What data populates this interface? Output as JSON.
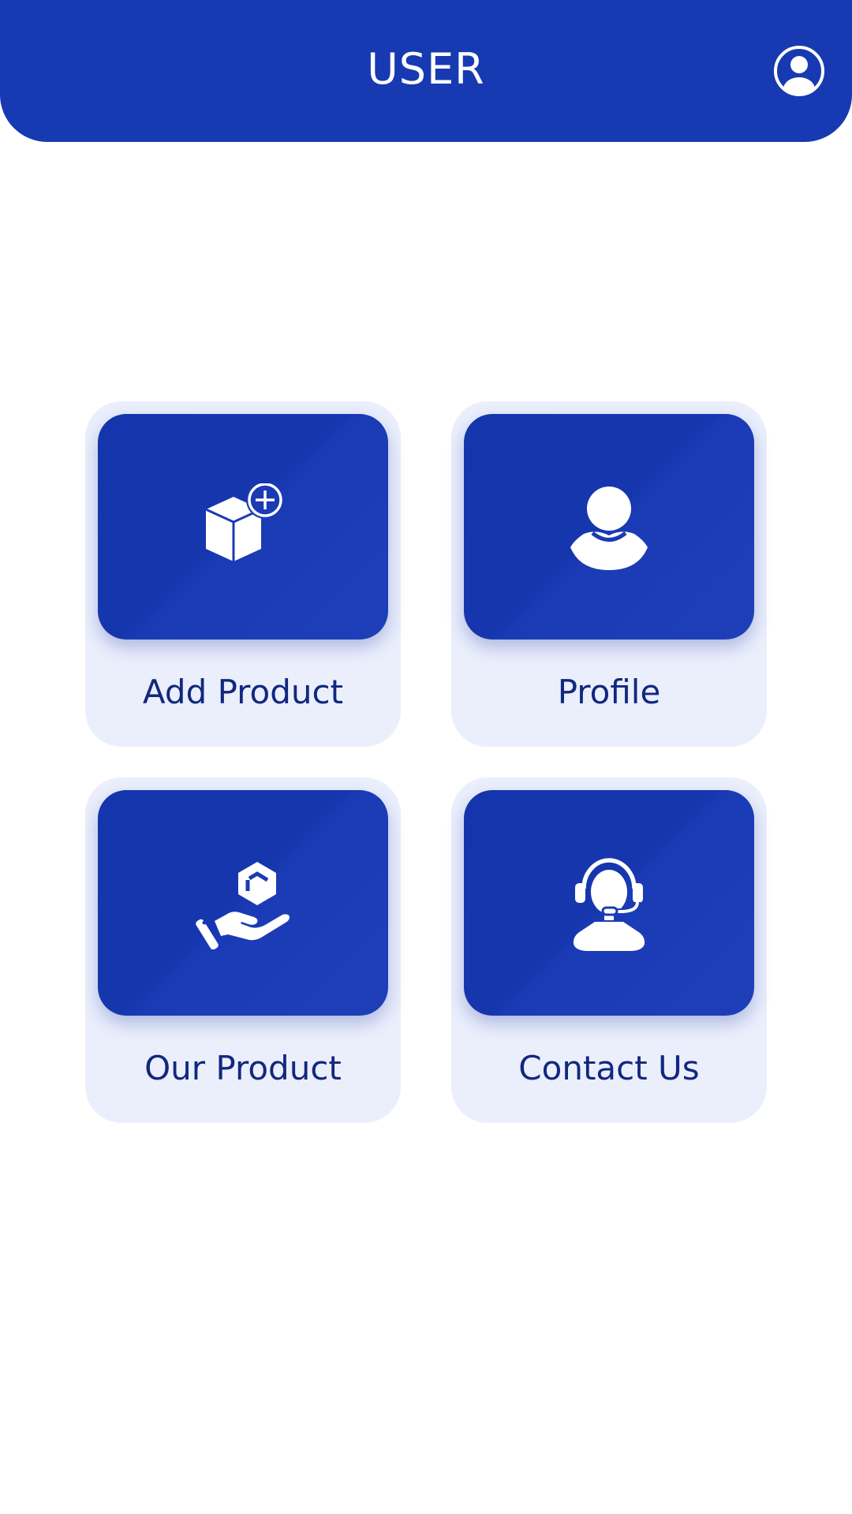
{
  "header": {
    "title": "USER",
    "avatar_icon": "account-circle-icon",
    "background": "#173AB2"
  },
  "menu": {
    "items": [
      {
        "label": "Add Product",
        "icon": "add-box-icon"
      },
      {
        "label": "Profile",
        "icon": "user-icon"
      },
      {
        "label": "Our Product",
        "icon": "hand-box-icon"
      },
      {
        "label": "Contact Us",
        "icon": "headset-support-icon"
      }
    ]
  },
  "colors": {
    "primary": "#173AB2",
    "card_background": "#EBEFFC",
    "label_text": "#12287E"
  }
}
